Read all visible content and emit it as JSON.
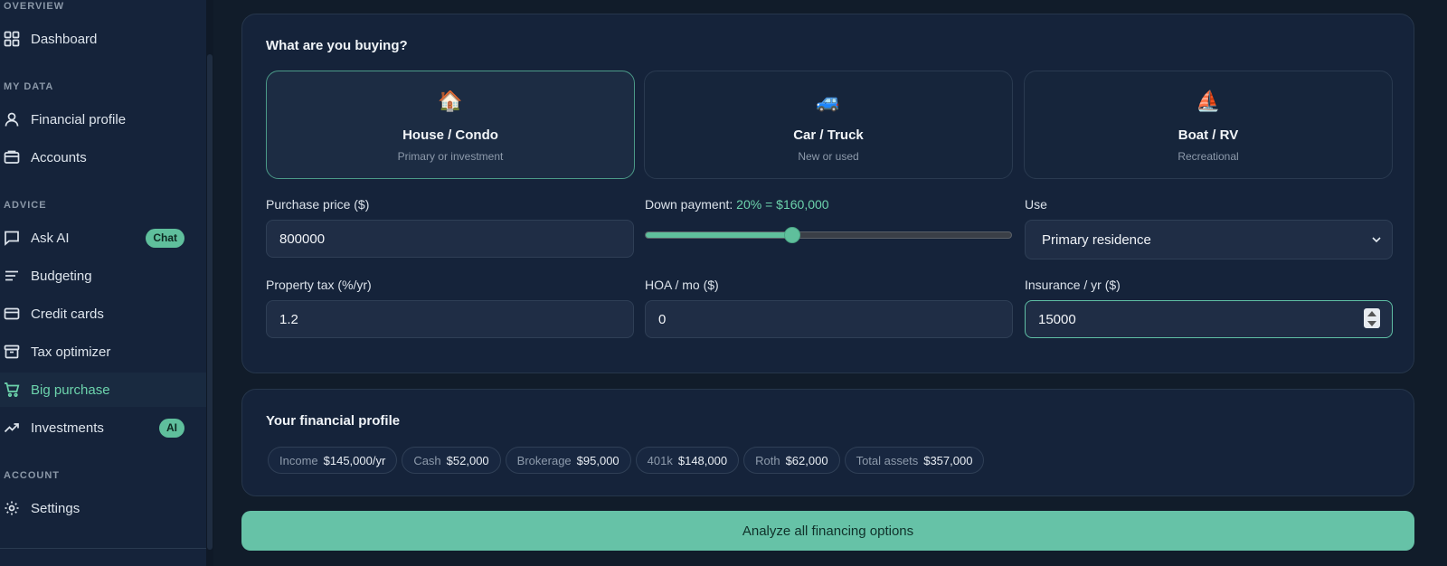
{
  "sidebar": {
    "sections": {
      "overview": "OVERVIEW",
      "my_data": "MY DATA",
      "advice": "ADVICE",
      "account": "ACCOUNT"
    },
    "items": {
      "dashboard": {
        "label": "Dashboard",
        "icon": "grid-icon"
      },
      "financial_profile": {
        "label": "Financial profile",
        "icon": "user-icon"
      },
      "accounts": {
        "label": "Accounts",
        "icon": "wallet-icon"
      },
      "ask_ai": {
        "label": "Ask AI",
        "icon": "chat-bubble-icon",
        "badge": "Chat"
      },
      "budgeting": {
        "label": "Budgeting",
        "icon": "lines-icon"
      },
      "credit_cards": {
        "label": "Credit cards",
        "icon": "credit-card-icon"
      },
      "tax_optimizer": {
        "label": "Tax optimizer",
        "icon": "archive-icon"
      },
      "big_purchase": {
        "label": "Big purchase",
        "icon": "cart-icon",
        "active": true
      },
      "investments": {
        "label": "Investments",
        "icon": "trend-up-icon",
        "badge": "AI"
      },
      "settings": {
        "label": "Settings",
        "icon": "sun-gear-icon"
      }
    }
  },
  "purchase_form": {
    "title": "What are you buying?",
    "options": [
      {
        "emoji": "🏠",
        "label": "House / Condo",
        "sub": "Primary or investment",
        "selected": true
      },
      {
        "emoji": "🚙",
        "label": "Car / Truck",
        "sub": "New or used",
        "selected": false
      },
      {
        "emoji": "⛵",
        "label": "Boat / RV",
        "sub": "Recreational",
        "selected": false
      }
    ],
    "purchase_price": {
      "label": "Purchase price ($)",
      "value": "800000"
    },
    "down_payment": {
      "label": "Down payment:",
      "percent": "20%",
      "equals": "=",
      "amount": "$160,000",
      "fraction": 0.2
    },
    "use": {
      "label": "Use",
      "value": "Primary residence"
    },
    "property_tax": {
      "label": "Property tax (%/yr)",
      "value": "1.2"
    },
    "hoa": {
      "label": "HOA / mo ($)",
      "value": "0"
    },
    "insurance": {
      "label": "Insurance / yr ($)",
      "value": "15000"
    }
  },
  "profile": {
    "title": "Your financial profile",
    "chips": [
      {
        "k": "Income",
        "v": "$145,000/yr"
      },
      {
        "k": "Cash",
        "v": "$52,000"
      },
      {
        "k": "Brokerage",
        "v": "$95,000"
      },
      {
        "k": "401k",
        "v": "$148,000"
      },
      {
        "k": "Roth",
        "v": "$62,000"
      },
      {
        "k": "Total assets",
        "v": "$357,000"
      }
    ]
  },
  "cta": {
    "label": "Analyze all financing options"
  },
  "colors": {
    "accent": "#6cd3ac",
    "button": "#66c2a7",
    "background": "#111c2a",
    "panel": "#15233a"
  }
}
